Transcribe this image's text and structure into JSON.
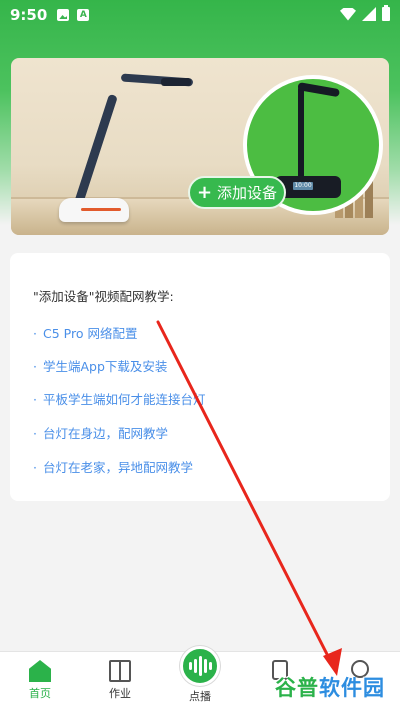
{
  "status_bar": {
    "time": "9:50"
  },
  "banner": {
    "add_device_label": "添加设备",
    "plus_symbol": "+",
    "mini_lamp_screen": "10:00"
  },
  "tutorial": {
    "title": "\"添加设备\"视频配网教学:",
    "bullet": "·",
    "items": [
      "C5 Pro 网络配置",
      "学生端App下载及安装",
      "平板学生端如何才能连接台灯",
      "台灯在身边，配网教学",
      "台灯在老家，异地配网教学"
    ]
  },
  "bottom_nav": {
    "home": "首页",
    "homework": "作业",
    "center": "点播"
  },
  "watermark": {
    "part1": "谷普",
    "part2": "软件园"
  },
  "colors": {
    "primary_green": "#2bb24a",
    "link_blue": "#4a8fe8",
    "arrow_red": "#e8261c"
  }
}
